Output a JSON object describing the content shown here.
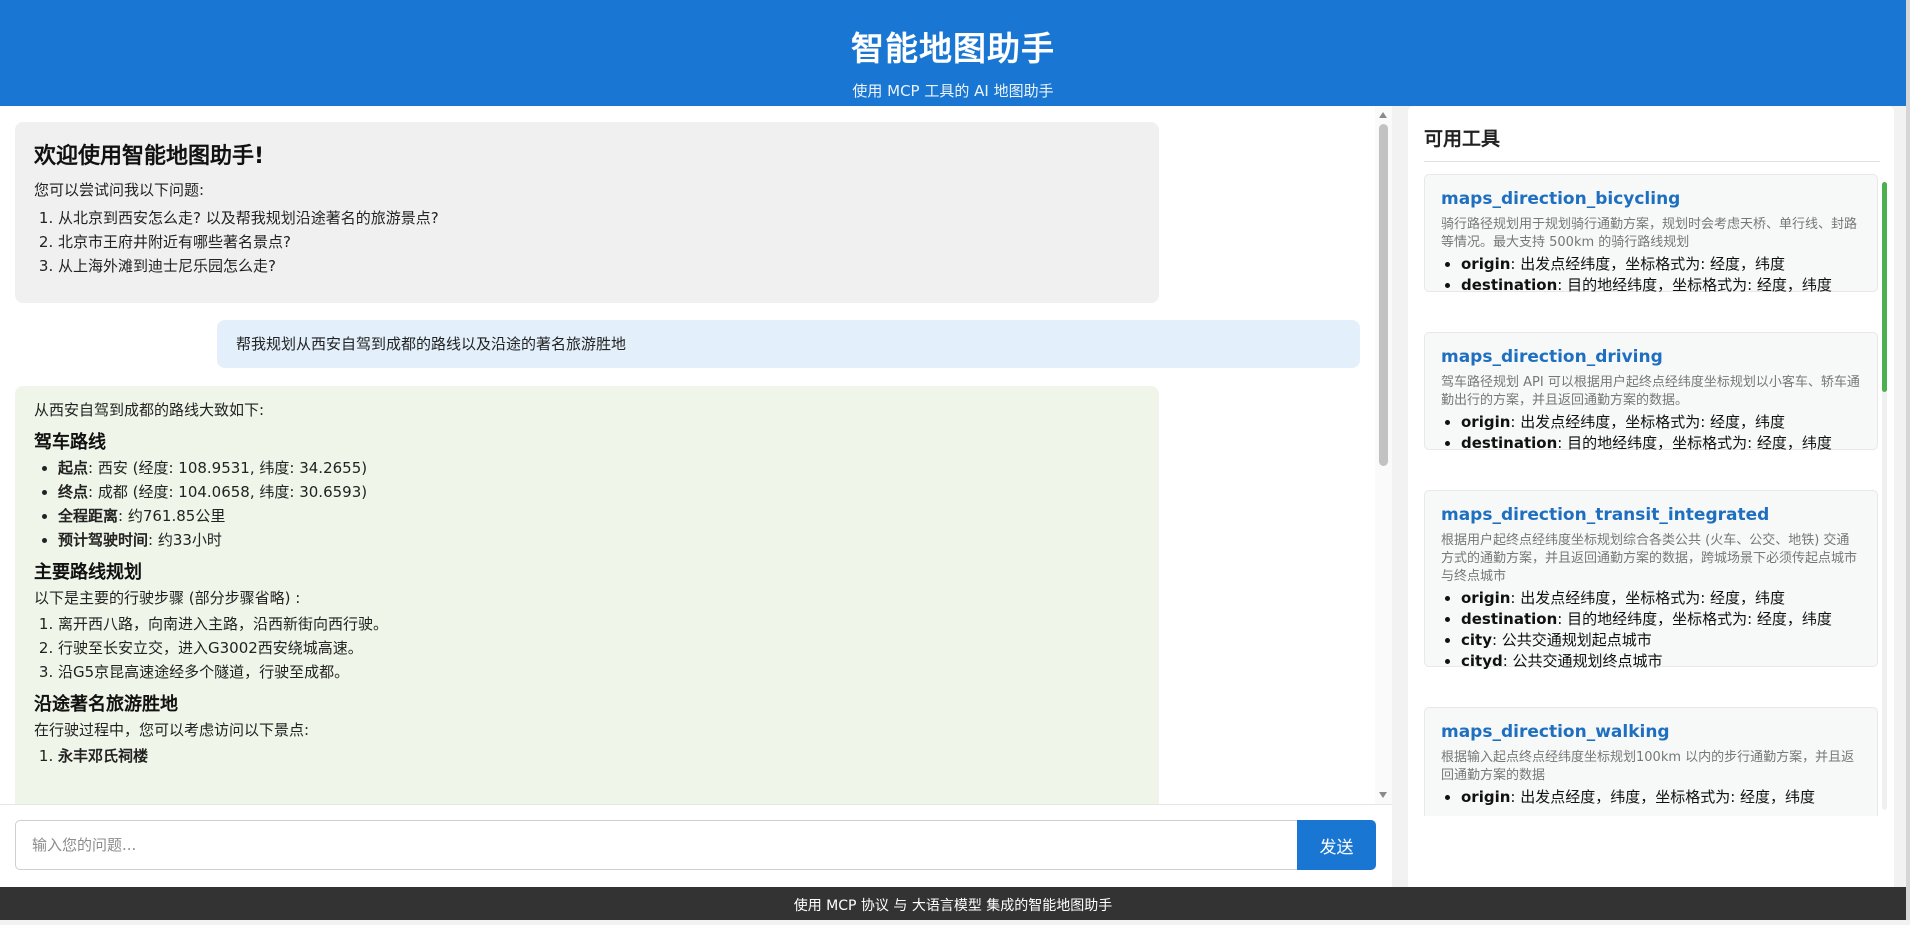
{
  "header": {
    "title": "智能地图助手",
    "subtitle": "使用 MCP 工具的 AI 地图助手"
  },
  "chat": {
    "welcome": {
      "title": "欢迎使用智能地图助手!",
      "intro": "您可以尝试问我以下问题:",
      "questions": [
        "从北京到西安怎么走? 以及帮我规划沿途著名的旅游景点?",
        "北京市王府井附近有哪些著名景点?",
        "从上海外滩到迪士尼乐园怎么走?"
      ]
    },
    "user_message": "帮我规划从西安自驾到成都的路线以及沿途的著名旅游胜地",
    "reply": {
      "intro": "从西安自驾到成都的路线大致如下:",
      "section1_title": "驾车路线",
      "route_items": [
        {
          "label": "起点",
          "text": ": 西安 (经度: 108.9531, 纬度: 34.2655)"
        },
        {
          "label": "终点",
          "text": ": 成都 (经度: 104.0658, 纬度: 30.6593)"
        },
        {
          "label": "全程距离",
          "text": ": 约761.85公里"
        },
        {
          "label": "预计驾驶时间",
          "text": ": 约33小时"
        }
      ],
      "section2_title": "主要路线规划",
      "steps_intro": "以下是主要的行驶步骤 (部分步骤省略) :",
      "steps": [
        "离开西八路，向南进入主路，沿西新街向西行驶。",
        "行驶至长安立交，进入G3002西安绕城高速。",
        "沿G5京昆高速途经多个隧道，行驶至成都。"
      ],
      "section3_title": "沿途著名旅游胜地",
      "sights_intro": "在行驶过程中，您可以考虑访问以下景点:",
      "sights": [
        "永丰邓氏祠楼"
      ]
    },
    "input_placeholder": "输入您的问题...",
    "send_label": "发送"
  },
  "tools": {
    "title": "可用工具",
    "items": [
      {
        "name": "maps_direction_bicycling",
        "desc": "骑行路径规划用于规划骑行通勤方案，规划时会考虑天桥、单行线、封路等情况。最大支持 500km 的骑行路线规划",
        "params": [
          {
            "key": "origin",
            "text": ": 出发点经纬度，坐标格式为: 经度，纬度"
          },
          {
            "key": "destination",
            "text": ": 目的地经纬度，坐标格式为: 经度，纬度"
          }
        ]
      },
      {
        "name": "maps_direction_driving",
        "desc": "驾车路径规划 API 可以根据用户起终点经纬度坐标规划以小客车、轿车通勤出行的方案，并且返回通勤方案的数据。",
        "params": [
          {
            "key": "origin",
            "text": ": 出发点经纬度，坐标格式为: 经度，纬度"
          },
          {
            "key": "destination",
            "text": ": 目的地经纬度，坐标格式为: 经度，纬度"
          }
        ]
      },
      {
        "name": "maps_direction_transit_integrated",
        "desc": "根据用户起终点经纬度坐标规划综合各类公共 (火车、公交、地铁) 交通方式的通勤方案，并且返回通勤方案的数据，跨城场景下必须传起点城市与终点城市",
        "params": [
          {
            "key": "origin",
            "text": ": 出发点经纬度，坐标格式为: 经度，纬度"
          },
          {
            "key": "destination",
            "text": ": 目的地经纬度，坐标格式为: 经度，纬度"
          },
          {
            "key": "city",
            "text": ": 公共交通规划起点城市"
          },
          {
            "key": "cityd",
            "text": ": 公共交通规划终点城市"
          }
        ]
      },
      {
        "name": "maps_direction_walking",
        "desc": "根据输入起点终点经纬度坐标规划100km 以内的步行通勤方案，并且返回通勤方案的数据",
        "params": [
          {
            "key": "origin",
            "text": ": 出发点经度，纬度，坐标格式为: 经度，纬度"
          }
        ]
      }
    ]
  },
  "footer": {
    "text": "使用 MCP 协议 与 大语言模型 集成的智能地图助手"
  },
  "colors": {
    "primary": "#1976d2",
    "user_bubble": "#e3f0fb",
    "reply_bubble": "#eff6e9",
    "welcome_bubble": "#f0f0f0",
    "tool_name": "#1f6fc1",
    "footer_bg": "#333333",
    "tools_scroll": "#4caf50"
  }
}
